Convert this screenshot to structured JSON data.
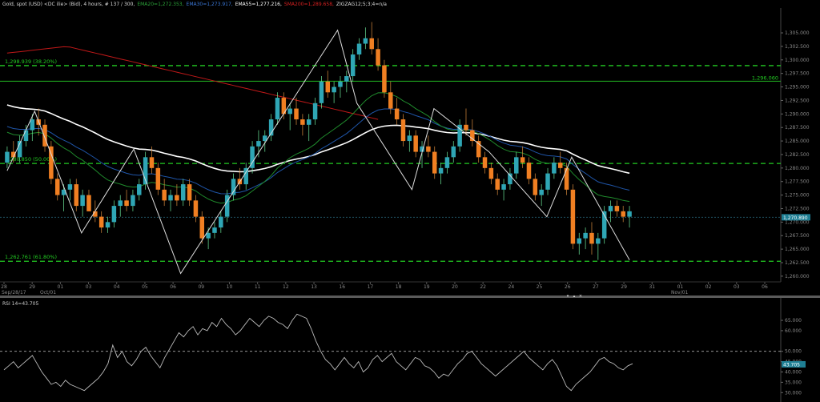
{
  "header": {
    "instrument": "Gold, spot (USD) <DC ilie> (Bid), 4 hours, # 137 / 300,",
    "ema20": "EMA20=1,272.353,",
    "ema30": "EMA30=1,273.917,",
    "ema55": "EMA55=1,277.216,",
    "sma200": "SMA200=1,289.658,",
    "zigzag": "ZIGZAG12;5;3;4=n/a"
  },
  "rsi_label": "RSI 14=43.705",
  "colors": {
    "bull": "#2fa6b5",
    "bear": "#f07f22",
    "ema20": "#1f8a2c",
    "ema30": "#1f55a8",
    "ema55": "#ffffff",
    "sma200": "#c01818",
    "zigzag": "#dddddd",
    "fib": "#22cc22",
    "hline": "#22bb22",
    "price_line": "#1f4f60"
  },
  "chart_data": [
    {
      "type": "candlestick",
      "ylim": [
        1258.5,
        1309.3
      ],
      "yticks": [
        "1,260.000",
        "1,262.500",
        "1,265.000",
        "1,267.500",
        "1,270.000",
        "1,272.500",
        "1,275.000",
        "1,277.500",
        "1,280.000",
        "1,282.500",
        "1,285.000",
        "1,287.500",
        "1,290.000",
        "1,292.500",
        "1,295.000",
        "1,297.500",
        "1,300.000",
        "1,302.500",
        "1,305.000"
      ],
      "xticks": [
        "28",
        "29",
        "01",
        "03",
        "04",
        "05",
        "06",
        "09",
        "10",
        "11",
        "12",
        "13",
        "16",
        "17",
        "18",
        "19",
        "20",
        "22",
        "24",
        "25",
        "26",
        "27",
        "29",
        "31",
        "01",
        "02",
        "03",
        "06"
      ],
      "xsub": [
        "Sep/28/17",
        "Oct/01",
        "Nov/01"
      ],
      "candles": [
        [
          1281,
          1284,
          1280,
          1283
        ],
        [
          1283,
          1285,
          1281,
          1282
        ],
        [
          1282,
          1286,
          1281,
          1285
        ],
        [
          1285,
          1288,
          1284,
          1287
        ],
        [
          1287,
          1290,
          1285,
          1289
        ],
        [
          1289,
          1291,
          1286,
          1288
        ],
        [
          1288,
          1289,
          1283,
          1284
        ],
        [
          1284,
          1285,
          1277,
          1278
        ],
        [
          1278,
          1279,
          1274,
          1275
        ],
        [
          1275,
          1277,
          1272,
          1276
        ],
        [
          1276,
          1278,
          1274,
          1277
        ],
        [
          1277,
          1278,
          1272,
          1273
        ],
        [
          1273,
          1276,
          1271,
          1275
        ],
        [
          1275,
          1276,
          1272,
          1272
        ],
        [
          1272,
          1274,
          1270,
          1271
        ],
        [
          1271,
          1272,
          1268,
          1269
        ],
        [
          1269,
          1271,
          1268,
          1270
        ],
        [
          1270,
          1274,
          1269,
          1273
        ],
        [
          1273,
          1275,
          1271,
          1274
        ],
        [
          1274,
          1276,
          1272,
          1273
        ],
        [
          1273,
          1276,
          1272,
          1275
        ],
        [
          1275,
          1278,
          1274,
          1277
        ],
        [
          1277,
          1283,
          1276,
          1282
        ],
        [
          1282,
          1284,
          1279,
          1280
        ],
        [
          1280,
          1281,
          1275,
          1276
        ],
        [
          1276,
          1278,
          1273,
          1274
        ],
        [
          1274,
          1276,
          1272,
          1275
        ],
        [
          1275,
          1277,
          1273,
          1274
        ],
        [
          1274,
          1278,
          1273,
          1277
        ],
        [
          1277,
          1278,
          1273,
          1274
        ],
        [
          1274,
          1275,
          1270,
          1271
        ],
        [
          1271,
          1272,
          1266,
          1267
        ],
        [
          1267,
          1269,
          1265,
          1268
        ],
        [
          1268,
          1270,
          1267,
          1269
        ],
        [
          1269,
          1272,
          1268,
          1271
        ],
        [
          1271,
          1276,
          1270,
          1275
        ],
        [
          1275,
          1279,
          1274,
          1278
        ],
        [
          1278,
          1280,
          1276,
          1277
        ],
        [
          1277,
          1281,
          1276,
          1280
        ],
        [
          1280,
          1285,
          1279,
          1284
        ],
        [
          1284,
          1287,
          1282,
          1285
        ],
        [
          1285,
          1287,
          1283,
          1286
        ],
        [
          1286,
          1290,
          1285,
          1289
        ],
        [
          1289,
          1294,
          1288,
          1293
        ],
        [
          1293,
          1294,
          1289,
          1290
        ],
        [
          1290,
          1292,
          1287,
          1291
        ],
        [
          1291,
          1293,
          1288,
          1289
        ],
        [
          1289,
          1290,
          1286,
          1288
        ],
        [
          1288,
          1290,
          1285,
          1289
        ],
        [
          1289,
          1293,
          1288,
          1292
        ],
        [
          1292,
          1297,
          1291,
          1296
        ],
        [
          1296,
          1298,
          1293,
          1294
        ],
        [
          1294,
          1296,
          1292,
          1295
        ],
        [
          1295,
          1297,
          1293,
          1296
        ],
        [
          1296,
          1298,
          1294,
          1297
        ],
        [
          1297,
          1302,
          1296,
          1301
        ],
        [
          1301,
          1304,
          1300,
          1303
        ],
        [
          1303,
          1306,
          1302,
          1304
        ],
        [
          1304,
          1307,
          1301,
          1302
        ],
        [
          1302,
          1304,
          1298,
          1299
        ],
        [
          1299,
          1300,
          1293,
          1294
        ],
        [
          1294,
          1296,
          1290,
          1291
        ],
        [
          1291,
          1293,
          1288,
          1289
        ],
        [
          1289,
          1290,
          1284,
          1285
        ],
        [
          1285,
          1287,
          1283,
          1286
        ],
        [
          1286,
          1287,
          1282,
          1283
        ],
        [
          1283,
          1285,
          1280,
          1284
        ],
        [
          1284,
          1286,
          1282,
          1283
        ],
        [
          1283,
          1284,
          1278,
          1279
        ],
        [
          1279,
          1281,
          1277,
          1280
        ],
        [
          1280,
          1283,
          1279,
          1282
        ],
        [
          1282,
          1285,
          1281,
          1284
        ],
        [
          1284,
          1289,
          1283,
          1288
        ],
        [
          1288,
          1291,
          1286,
          1287
        ],
        [
          1287,
          1289,
          1284,
          1285
        ],
        [
          1285,
          1286,
          1281,
          1282
        ],
        [
          1282,
          1283,
          1279,
          1280
        ],
        [
          1280,
          1281,
          1277,
          1278
        ],
        [
          1278,
          1279,
          1275,
          1276
        ],
        [
          1276,
          1278,
          1274,
          1277
        ],
        [
          1277,
          1280,
          1276,
          1279
        ],
        [
          1279,
          1283,
          1278,
          1282
        ],
        [
          1282,
          1284,
          1280,
          1281
        ],
        [
          1281,
          1282,
          1277,
          1278
        ],
        [
          1278,
          1279,
          1274,
          1275
        ],
        [
          1275,
          1277,
          1273,
          1276
        ],
        [
          1276,
          1280,
          1275,
          1279
        ],
        [
          1279,
          1282,
          1278,
          1281
        ],
        [
          1281,
          1283,
          1279,
          1280
        ],
        [
          1280,
          1281,
          1275,
          1276
        ],
        [
          1276,
          1277,
          1265,
          1266
        ],
        [
          1266,
          1268,
          1264,
          1267
        ],
        [
          1267,
          1269,
          1265,
          1268
        ],
        [
          1268,
          1270,
          1264,
          1266
        ],
        [
          1266,
          1268,
          1263,
          1267
        ],
        [
          1267,
          1273,
          1266,
          1272
        ],
        [
          1272,
          1274,
          1270,
          1273
        ],
        [
          1273,
          1274,
          1271,
          1272
        ],
        [
          1272,
          1273,
          1270,
          1271
        ],
        [
          1271,
          1273,
          1269,
          1272
        ]
      ],
      "ema20_label": "EMA20",
      "sma200_label": "SMA200",
      "fib": [
        {
          "value": 1298.939,
          "label": "1,298.939 (38.20%)"
        },
        {
          "value": 1280.85,
          "label": "1,280.850 (50.00%)"
        },
        {
          "value": 1262.761,
          "label": "1,262.761 (61.80%)"
        }
      ],
      "hline": {
        "value": 1296.06,
        "label": "1,296.060"
      },
      "last_price": {
        "value": 1270.89,
        "label": "1,270.890"
      },
      "zigzag": [
        [
          0,
          1279.5
        ],
        [
          10,
          1290.5
        ],
        [
          27,
          1268
        ],
        [
          46,
          1283.5
        ],
        [
          63,
          1260.5
        ],
        [
          120,
          1305.5
        ],
        [
          127,
          1292
        ],
        [
          147,
          1276
        ],
        [
          155,
          1291
        ],
        [
          175,
          1283
        ],
        [
          196,
          1271
        ],
        [
          205,
          1282
        ],
        [
          226,
          1263
        ]
      ]
    },
    {
      "type": "line",
      "name": "RSI 14",
      "ylim": [
        27,
        72
      ],
      "yticks": [
        "65.000",
        "60.000",
        "50.000",
        "45.000",
        "40.000",
        "35.000",
        "30.000"
      ],
      "level": 50,
      "last": {
        "value": 43.705,
        "label": "43.705"
      },
      "values": [
        41,
        43,
        45,
        42,
        44,
        46,
        48,
        44,
        40,
        37,
        34,
        35,
        33,
        36,
        34,
        33,
        32,
        31,
        33,
        35,
        37,
        40,
        44,
        53,
        47,
        50,
        45,
        43,
        46,
        50,
        52,
        48,
        45,
        42,
        47,
        51,
        55,
        59,
        57,
        60,
        62,
        58,
        61,
        60,
        64,
        62,
        66,
        63,
        61,
        58,
        60,
        63,
        66,
        64,
        62,
        65,
        67,
        66,
        64,
        63,
        61,
        65,
        68,
        67,
        66,
        61,
        55,
        50,
        46,
        44,
        41,
        44,
        47,
        44,
        42,
        45,
        40,
        42,
        46,
        48,
        45,
        47,
        49,
        45,
        43,
        41,
        44,
        47,
        46,
        43,
        42,
        40,
        37,
        39,
        38,
        41,
        44,
        46,
        49,
        50,
        47,
        44,
        42,
        40,
        38,
        40,
        42,
        44,
        46,
        48,
        50,
        47,
        45,
        43,
        41,
        44,
        46,
        43,
        38,
        33,
        31,
        34,
        36,
        38,
        40,
        43,
        46,
        47,
        45,
        44,
        42,
        41,
        43,
        44
      ]
    }
  ]
}
